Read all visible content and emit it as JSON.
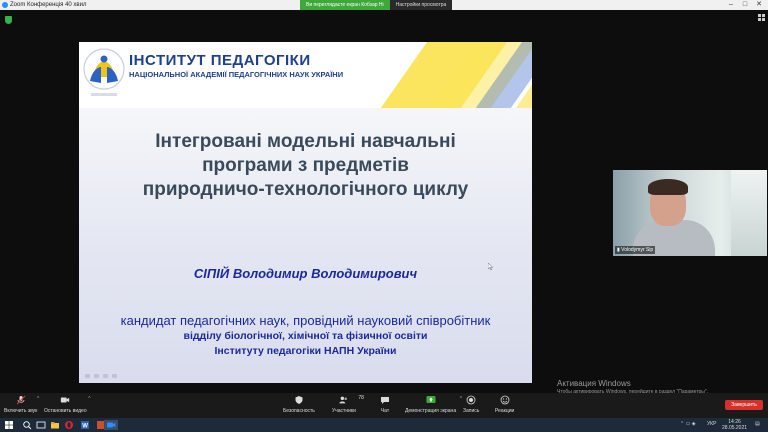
{
  "window": {
    "title": "Zoom Конференція 40 хвил"
  },
  "share_banner": {
    "status": "Ви переглядаєте екран Кобзар Ні",
    "view_options": "Настройки просмотра"
  },
  "slide": {
    "institute_name": "ІНСТИТУТ ПЕДАГОГІКИ",
    "institute_sub": "НАЦІОНАЛЬНОЇ АКАДЕМІЇ ПЕДАГОГІЧНИХ НАУК УКРАЇНИ",
    "title_line1": "Інтегровані модельні навчальні",
    "title_line2": "програми з предметів",
    "title_line3": "природничо-технологічного циклу",
    "author": "СІПІЙ Володимир Володимирович",
    "degree_line1": "кандидат педагогічних наук, провідний науковий співробітник",
    "degree_line2": "відділу біологічної, хімічної та фізичної освіти",
    "degree_line3": "Інституту педагогіки НАПН України"
  },
  "video": {
    "participant_label": "Volodymyr Sip"
  },
  "activation": {
    "title": "Активация Windows",
    "subtitle": "Чтобы активировать Windows, перейдите в раздел \"Параметры\"."
  },
  "toolbar": {
    "mute": "Включить звук",
    "video": "Остановить видео",
    "security": "Безопасность",
    "participants": "Участники",
    "participants_count": "78",
    "chat": "Чат",
    "share": "Демонстрация экрана",
    "record": "Запись",
    "reactions": "Реакции",
    "end": "Завершить"
  },
  "taskbar": {
    "lang": "УКР",
    "time": "14:26",
    "date": "28.05.2021"
  },
  "colors": {
    "zoom_blue": "#2d8cff",
    "share_green": "#3ea83a",
    "end_red": "#d6302a",
    "slide_blue": "#1a2a9a"
  }
}
